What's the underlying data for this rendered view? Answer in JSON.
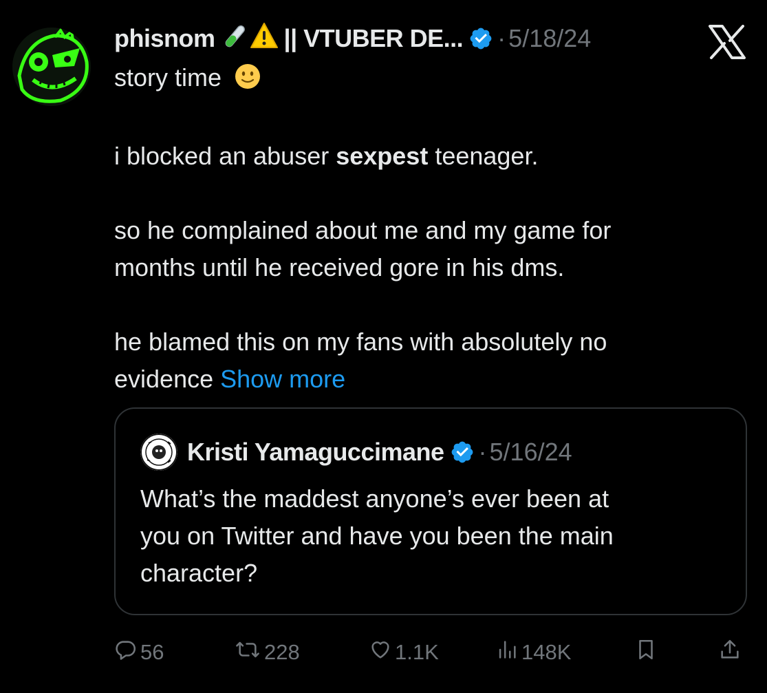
{
  "post": {
    "author_name": "phisnom",
    "author_suffix": "|| VTUBER DE...",
    "separator": "·",
    "date": "5/18/24",
    "lines": {
      "l1": "story time",
      "l2_before": "i blocked an abuser ",
      "l2_bold": "sexpest",
      "l2_after": " teenager.",
      "l3": "so he complained about me and my game for",
      "l4": "months until he received gore in his dms.",
      "l5": "he blamed this on my fans with absolutely no",
      "l6": "evidence "
    },
    "show_more": "Show more"
  },
  "quote": {
    "author_name": "Kristi Yamaguccimane",
    "separator": "·",
    "date": "5/16/24",
    "line1": "What’s the maddest anyone’s ever been at",
    "line2": "you on Twitter and have you been the main",
    "line3": "character?"
  },
  "actions": {
    "replies": "56",
    "reposts": "228",
    "likes": "1.1K",
    "views": "148K"
  },
  "icons": [
    "test-tube-icon",
    "warning-icon",
    "verified-badge-icon",
    "x-logo-icon",
    "slightly-smiling-face-icon",
    "reply-icon",
    "repost-icon",
    "like-icon",
    "views-icon",
    "bookmark-icon",
    "share-icon"
  ],
  "colors": {
    "background": "#000000",
    "text": "#e7e9ea",
    "secondary": "#71767b",
    "link": "#1d9bf0",
    "verified": "#1d9bf0",
    "avatar_accent": "#39ff14"
  }
}
